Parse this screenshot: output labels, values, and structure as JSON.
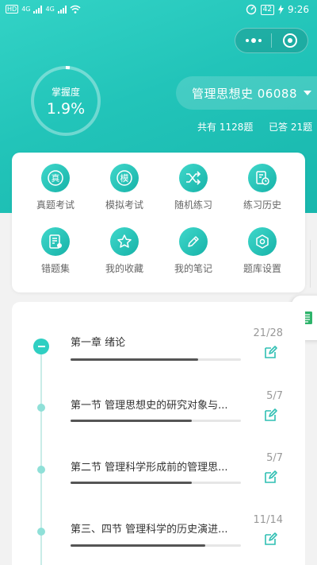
{
  "status_bar": {
    "sim1": "HD",
    "net1": "4G",
    "net2": "4G",
    "battery": "42",
    "time": "9:26"
  },
  "mastery": {
    "label": "掌握度",
    "value": "1.9%",
    "fraction": 0.019
  },
  "subject": {
    "name": "管理思想史 06088",
    "total_text": "共有 1128题",
    "answered_text": "已答 21题"
  },
  "features": [
    {
      "label": "真题考试",
      "icon": "real-exam-icon"
    },
    {
      "label": "模拟考试",
      "icon": "mock-exam-icon"
    },
    {
      "label": "随机练习",
      "icon": "shuffle-icon"
    },
    {
      "label": "练习历史",
      "icon": "history-icon"
    },
    {
      "label": "错题集",
      "icon": "wrong-questions-icon"
    },
    {
      "label": "我的收藏",
      "icon": "star-icon"
    },
    {
      "label": "我的笔记",
      "icon": "pencil-icon"
    },
    {
      "label": "题库设置",
      "icon": "settings-icon"
    }
  ],
  "chapters": [
    {
      "title": "第一章 绪论",
      "count": "21/28",
      "progress": 0.75
    },
    {
      "title": "第一节 管理思想史的研究对象与...",
      "count": "5/7",
      "progress": 0.71
    },
    {
      "title": "第二节 管理科学形成前的管理思...",
      "count": "5/7",
      "progress": 0.71
    },
    {
      "title": "第三、四节 管理科学的历史演进...",
      "count": "11/14",
      "progress": 0.79
    }
  ],
  "colors": {
    "accent": "#22c4b9",
    "accent_light": "#8fe0d8",
    "sheet_icon": "#2db36a"
  }
}
